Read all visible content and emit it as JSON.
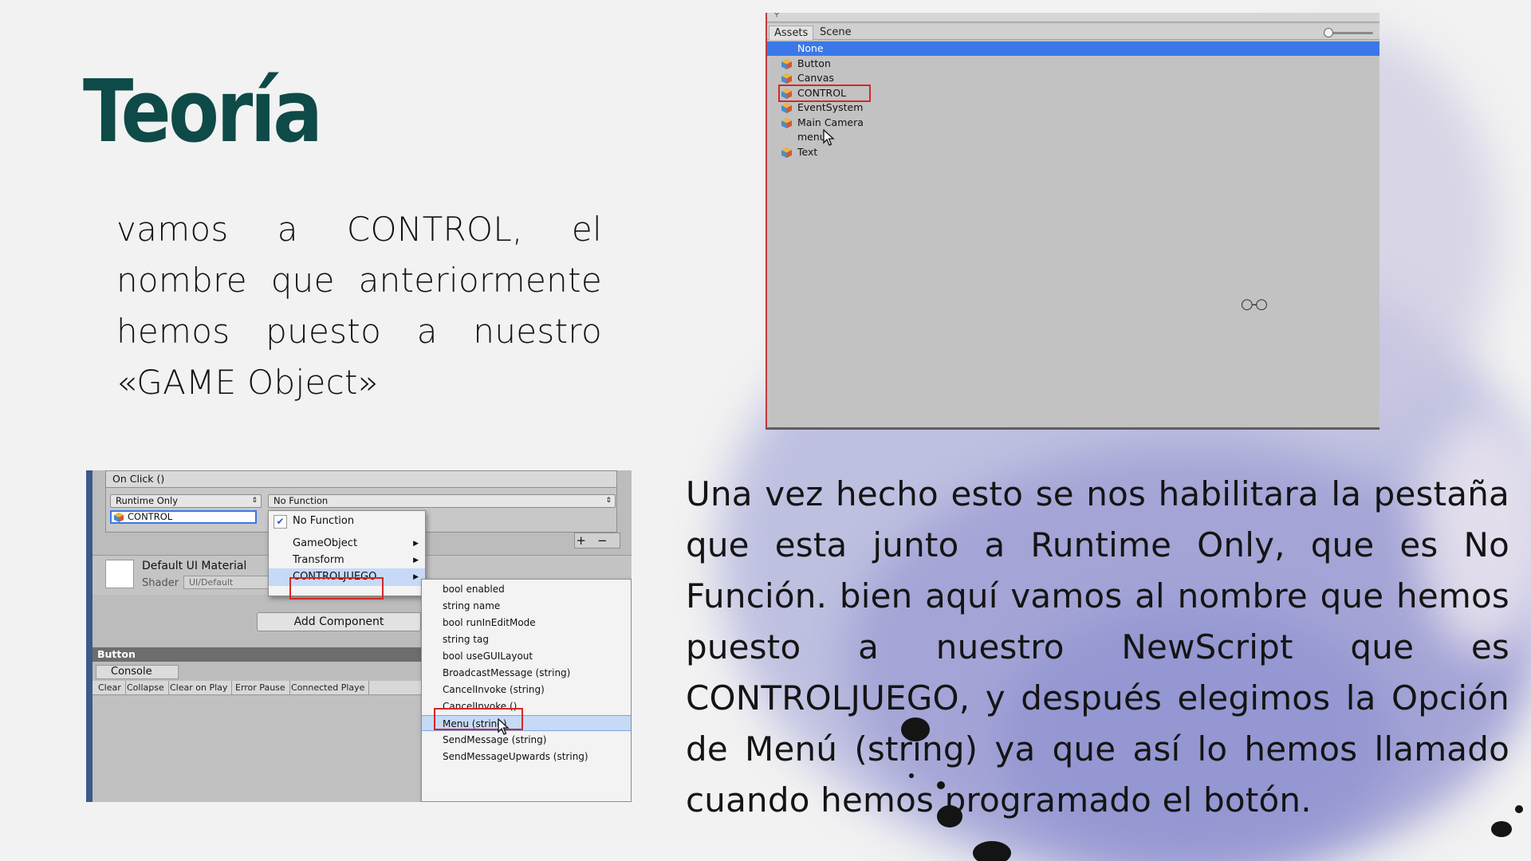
{
  "slide": {
    "title": "Teoría",
    "paragraph_left": "vamos a CONTROL, el nombre que anteriormente hemos puesto a nuestro «GAME Object»",
    "paragraph_right": "Una vez hecho esto se nos habilitara la pestaña que esta junto a Runtime Only, que es No Función. bien aquí vamos al nombre que hemos puesto a nuestro NewScript que es CONTROLJUEGO, y después elegimos la Opción de Menú (string) ya que así lo hemos llamado cuando hemos programado el botón.",
    "colors": {
      "title": "#0e4a47",
      "text": "#141414",
      "background": "#f2f2f2",
      "highlight_box": "#d42828",
      "selection": "#3b78e7"
    }
  },
  "object_picker": {
    "search_icon": "search-icon",
    "tabs": [
      "Assets",
      "Scene"
    ],
    "items": [
      "None",
      "Button",
      "Canvas",
      "CONTROL",
      "EventSystem",
      "Main Camera",
      "menu",
      "Text"
    ],
    "selected": "None",
    "highlighted": "CONTROL"
  },
  "inspector": {
    "onclick_header": "On Click ()",
    "runtime_dropdown": "Runtime Only",
    "function_dropdown": "No Function",
    "object_field": "CONTROL",
    "plus": "+",
    "minus": "−",
    "material_name": "Default UI Material",
    "shader_label": "Shader",
    "shader_value": "UI/Default",
    "add_component": "Add Component",
    "button_header": "Button",
    "console_tab": "Console",
    "console_buttons": [
      "Clear",
      "Collapse",
      "Clear on Play",
      "Error Pause",
      "Connected Playe"
    ],
    "menu1": [
      "No Function",
      "GameObject",
      "Transform",
      "CONTROLJUEGO"
    ],
    "menu2": [
      "bool enabled",
      "string name",
      "bool runInEditMode",
      "string tag",
      "bool useGUILayout",
      "BroadcastMessage (string)",
      "CancelInvoke (string)",
      "CancelInvoke ()",
      "Menu (string)",
      "SendMessage (string)",
      "SendMessageUpwards (string)"
    ],
    "menu2_highlighted": "Menu (string)"
  }
}
